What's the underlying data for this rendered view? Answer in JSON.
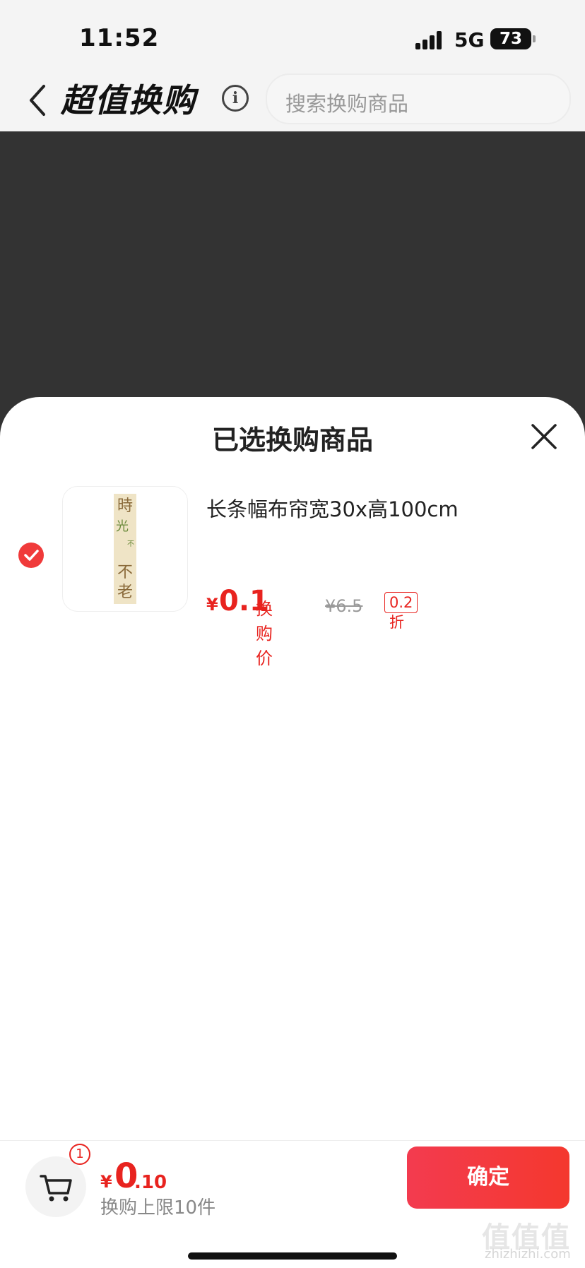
{
  "status_bar": {
    "time": "11:52",
    "network": "5G",
    "battery": "73"
  },
  "nav": {
    "title": "超值换购",
    "search_placeholder": "搜索换购商品"
  },
  "sheet": {
    "title": "已选换购商品",
    "items": [
      {
        "name": "长条幅布帘宽30x高100cm",
        "price_symbol": "¥",
        "price": "0.1",
        "price_label": "换购价",
        "original_price": "¥6.5",
        "discount": "0.2折",
        "selected": true,
        "thumb_text": "時光不老"
      }
    ]
  },
  "bottom": {
    "cart_count": "1",
    "total_symbol": "¥",
    "total_int": "0",
    "total_dec": ".10",
    "limit": "换购上限10件",
    "confirm": "确定"
  },
  "watermark": {
    "text": "值值值",
    "url": "zhizhizhi.com"
  },
  "colors": {
    "accent": "#e8231f",
    "overlay": "#333333",
    "button": "#f33b4f"
  }
}
